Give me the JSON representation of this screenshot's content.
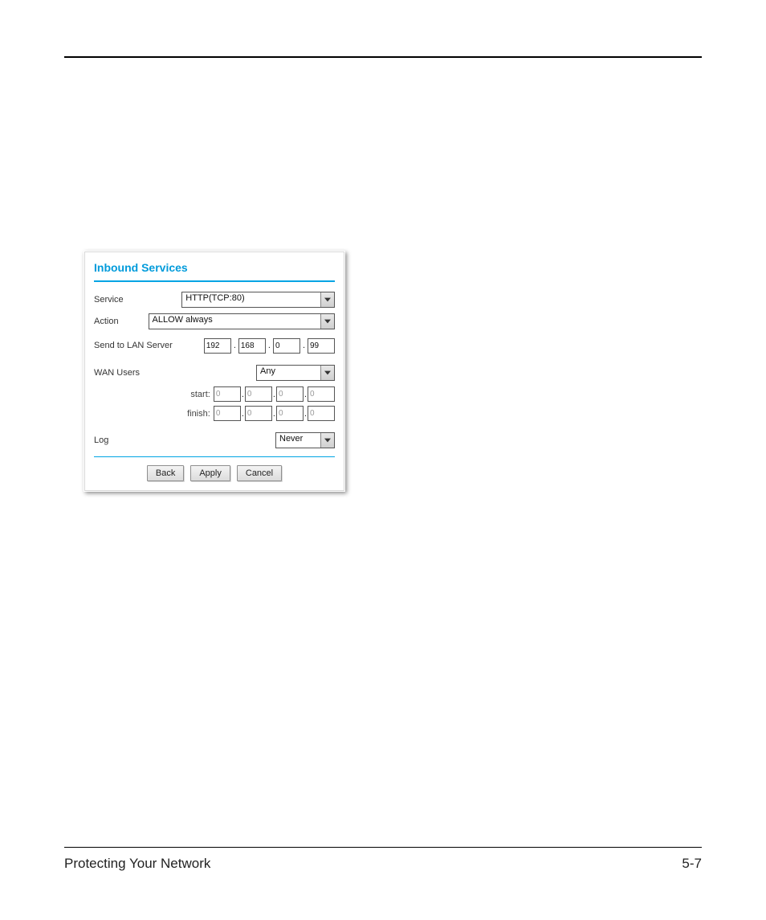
{
  "footer": {
    "left": "Protecting Your Network",
    "right": "5-7"
  },
  "panel": {
    "title": "Inbound Services",
    "service": {
      "label": "Service",
      "value": "HTTP(TCP:80)"
    },
    "action": {
      "label": "Action",
      "value": "ALLOW always"
    },
    "send_lan": {
      "label": "Send to LAN Server",
      "ip": {
        "a": "192",
        "b": "168",
        "c": "0",
        "d": "99"
      }
    },
    "wan_users": {
      "label": "WAN Users",
      "value": "Any",
      "start_label": "start:",
      "finish_label": "finish:",
      "start": {
        "a": "0",
        "b": "0",
        "c": "0",
        "d": "0"
      },
      "finish": {
        "a": "0",
        "b": "0",
        "c": "0",
        "d": "0"
      }
    },
    "log": {
      "label": "Log",
      "value": "Never"
    },
    "buttons": {
      "back": "Back",
      "apply": "Apply",
      "cancel": "Cancel"
    }
  }
}
